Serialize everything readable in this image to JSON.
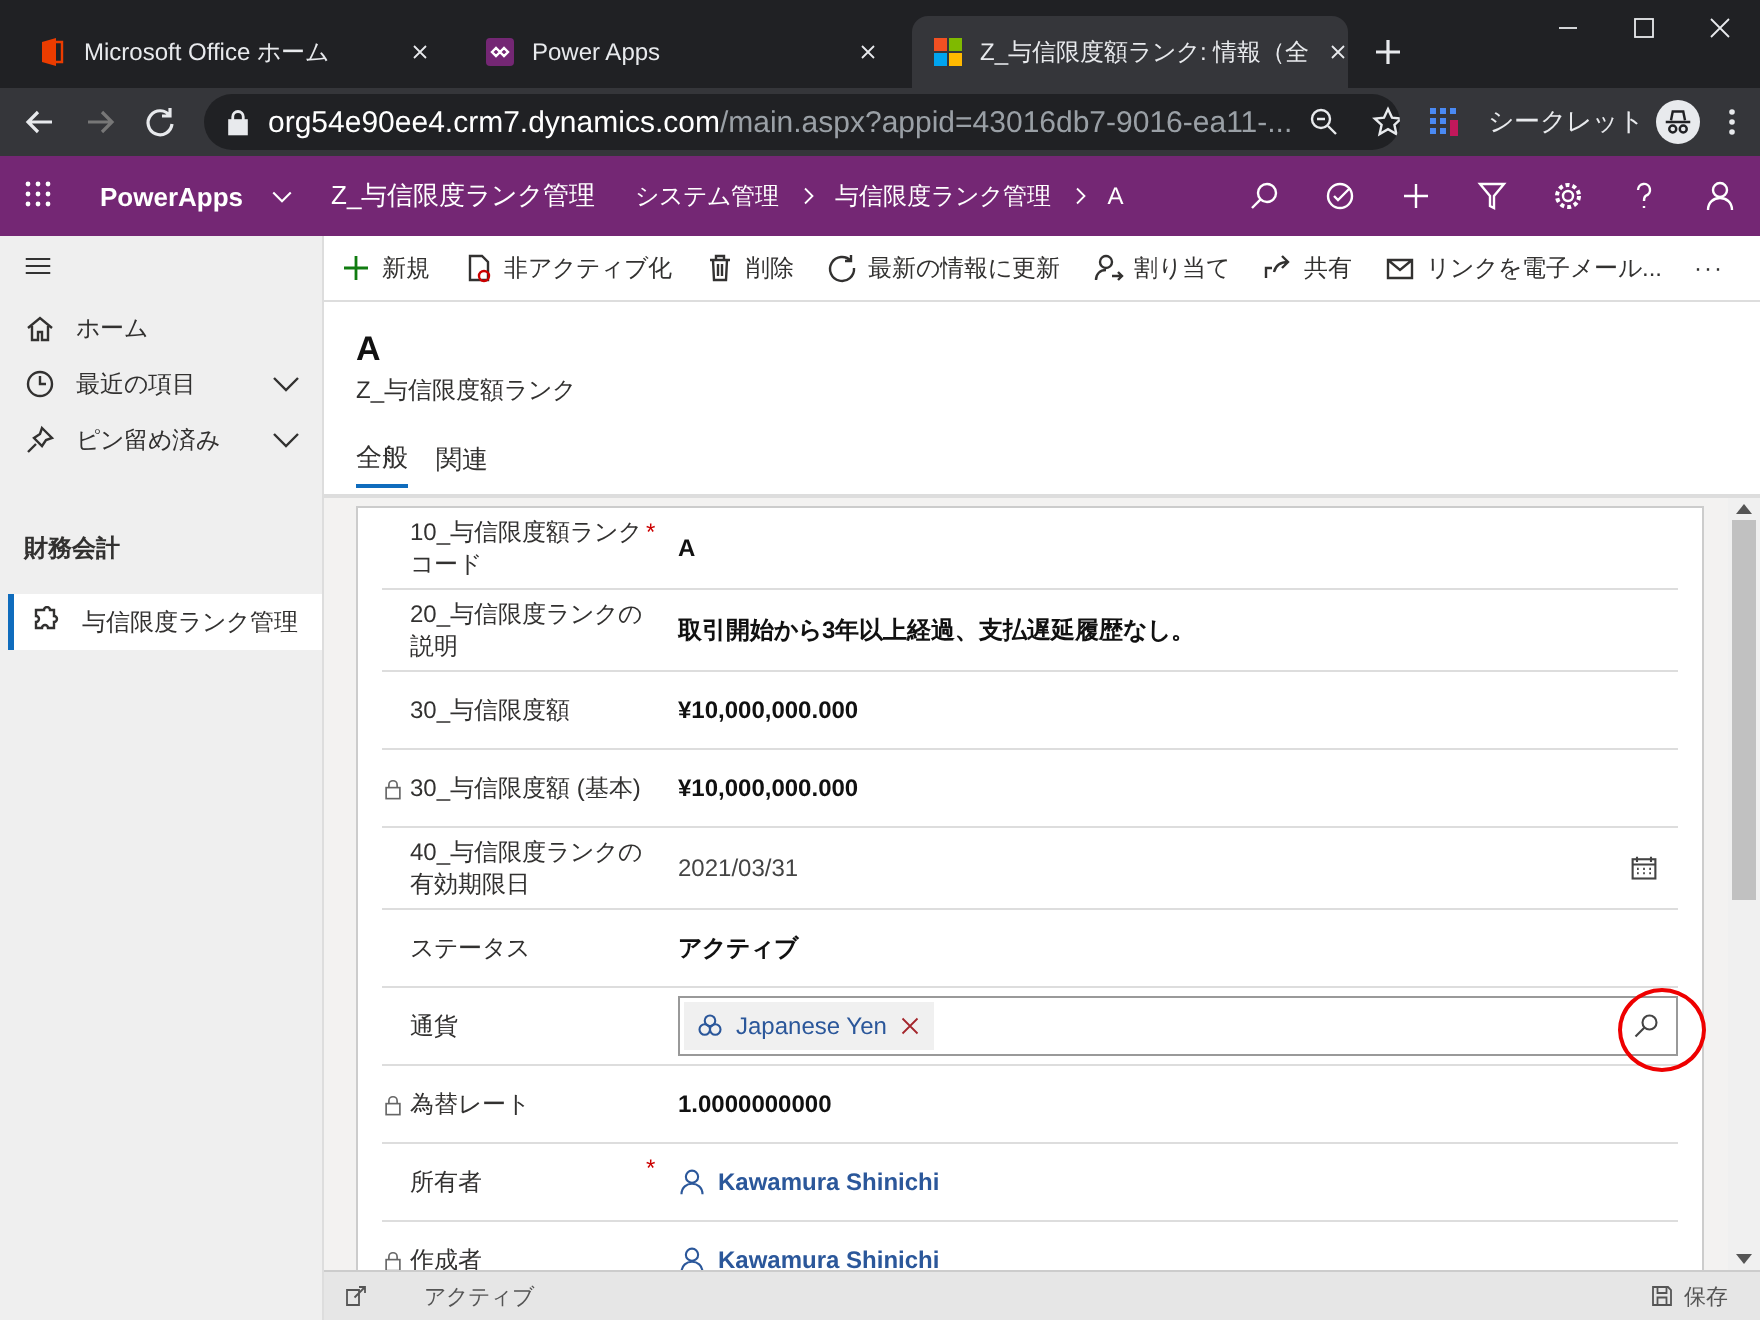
{
  "browser": {
    "tabs": [
      {
        "title": "Microsoft Office ホーム",
        "selected": false
      },
      {
        "title": "Power Apps",
        "selected": false
      },
      {
        "title": "Z_与信限度額ランク: 情報（全",
        "selected": true
      }
    ],
    "url_host": "org54e90ee4.crm7.dynamics.com",
    "url_path": "/main.aspx?appid=43016db7-9016-ea11-...",
    "incognito_label": "シークレット"
  },
  "app_header": {
    "brand": "PowerApps",
    "app_name": "Z_与信限度ランク管理",
    "breadcrumb": [
      "システム管理",
      "与信限度ランク管理",
      "A"
    ]
  },
  "sidebar": {
    "items": [
      {
        "label": "ホーム",
        "expandable": false,
        "selected": false
      },
      {
        "label": "最近の項目",
        "expandable": true,
        "selected": false
      },
      {
        "label": "ピン留め済み",
        "expandable": true,
        "selected": false
      }
    ],
    "section": "財務会計",
    "section_items": [
      {
        "label": "与信限度ランク管理",
        "selected": true
      }
    ]
  },
  "command_bar": [
    "新規",
    "非アクティブ化",
    "削除",
    "最新の情報に更新",
    "割り当て",
    "共有",
    "リンクを電子メール...",
    "···"
  ],
  "record": {
    "title": "A",
    "entity": "Z_与信限度額ランク"
  },
  "required_symbol": "*",
  "tabs": [
    {
      "label": "全般",
      "selected": true
    },
    {
      "label": "関連",
      "selected": false
    }
  ],
  "fields": [
    {
      "label": "10_与信限度額ランクコード",
      "required": true,
      "locked": false,
      "kind": "text",
      "value": "A"
    },
    {
      "label": "20_与信限度ランクの説明",
      "required": false,
      "locked": false,
      "kind": "text",
      "value": "取引開始から3年以上経過、支払遅延履歴なし。"
    },
    {
      "label": "30_与信限度額",
      "required": false,
      "locked": false,
      "kind": "text",
      "value": "¥10,000,000.000"
    },
    {
      "label": "30_与信限度額 (基本)",
      "required": false,
      "locked": true,
      "kind": "text",
      "value": "¥10,000,000.000"
    },
    {
      "label": "40_与信限度ランクの有効期限日",
      "required": false,
      "locked": false,
      "kind": "date",
      "value": "2021/03/31"
    },
    {
      "label": "ステータス",
      "required": false,
      "locked": false,
      "kind": "text",
      "value": "アクティブ"
    },
    {
      "label": "通貨",
      "required": false,
      "locked": false,
      "kind": "lookup",
      "value": "Japanese Yen"
    },
    {
      "label": "為替レート",
      "required": false,
      "locked": true,
      "kind": "text",
      "value": "1.0000000000"
    },
    {
      "label": "所有者",
      "required": true,
      "locked": false,
      "kind": "user",
      "value": "Kawamura Shinichi"
    },
    {
      "label": "作成者",
      "required": false,
      "locked": true,
      "kind": "user",
      "value": "Kawamura Shinichi"
    }
  ],
  "status_bar": {
    "status": "アクティブ",
    "save": "保存"
  }
}
